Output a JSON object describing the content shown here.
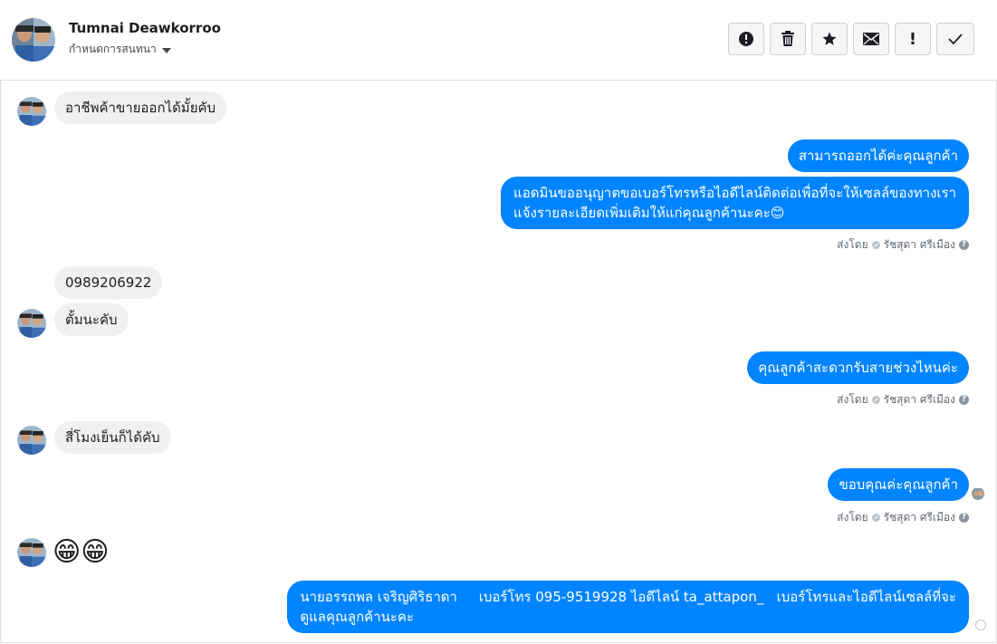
{
  "header": {
    "name": "Tumnai Deawkorroo",
    "subtitle": "กำหนดการสนทนา",
    "actions": [
      "spam",
      "delete",
      "star",
      "mark-unread",
      "important",
      "done"
    ],
    "important_label": "!"
  },
  "messages": [
    {
      "side": "in",
      "text": "อาชีพค้าขายออกได้มั้ยคับ"
    },
    {
      "side": "out",
      "text": "สามารถออกได้ค่ะคุณลูกค้า"
    },
    {
      "side": "out",
      "lines": [
        "แอดมินขออนุญาตขอเบอร์โทรหรือไอดีไลน์ติดต่อเพื่อที่จะให้เซลล์ของทางเรา",
        "แจ้งรายละเอียดเพิ่มเติมให้แก่คุณลูกค้านะคะ😊"
      ]
    },
    {
      "side": "in",
      "text": "0989206922"
    },
    {
      "side": "in",
      "text": "ตั้มนะคับ"
    },
    {
      "side": "out",
      "text": "คุณลูกค้าสะดวกรับสายช่วงไหนค่ะ"
    },
    {
      "side": "in",
      "text": "สี่โมงเย็นก็ได้คับ"
    },
    {
      "side": "out",
      "text": "ขอบคุณค่ะคุณลูกค้า"
    },
    {
      "side": "in",
      "text": "😁😁"
    },
    {
      "side": "out",
      "lines": [
        "นายอรรถพล เจริญศิริธาดา     เบอร์โทร 095-9519928 ไอดีไลน์ ta_attapon_   เบอร์โทรและไอดีไลน์เซลล์ที่จะ",
        "ดูแลคุณลูกค้านะคะ"
      ]
    }
  ],
  "sent_by": {
    "prefix": "ส่งโดย",
    "agent": "รัชสุดา ศรีเมือง",
    "help": "?"
  }
}
